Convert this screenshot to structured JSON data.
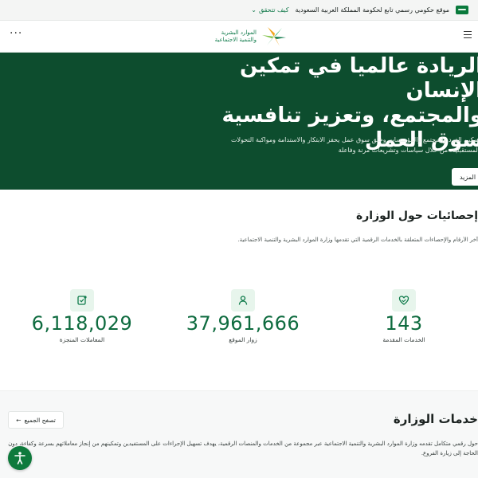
{
  "gov_bar": {
    "text": "موقع حكومي رسمي تابع لحكومة المملكة العربية السعودية",
    "verify_label": "كيف تتحقق"
  },
  "header": {
    "logo_line1": "الموارد البشرية",
    "logo_line2": "والتنمية الاجتماعية"
  },
  "hero": {
    "title_line1": "الريادة عالميا في تمكين الإنسان",
    "title_line2": "والمجتمع، وتعزيز تنافسية",
    "title_line3": "سوق العمل",
    "description_line1": "تمكين الفرد والمجتمع والمؤسسات وخلق سوق عمل يحفز الابتكار والاستدامة ومواكبة التحولات",
    "description_line2": "المستقبلية، من خلال سياسات وتشريعات مرنة وفاعلة",
    "more_label": "المزيد"
  },
  "stats": {
    "title": "إحصائيات حول الوزارة",
    "description": "آخر الأرقام والإحصاءات المتعلقة بالخدمات الرقمية التي تقدمها وزارة الموارد البشرية والتنمية الاجتماعية.",
    "items": [
      {
        "value": "143",
        "label": "الخدمات المقدمة",
        "icon": "heart-hand-icon"
      },
      {
        "value": "37,961,666",
        "label": "زوار الموقع",
        "icon": "user-icon"
      },
      {
        "value": "6,118,029",
        "label": "المعاملات المنجزة",
        "icon": "document-check-icon"
      }
    ]
  },
  "services": {
    "title": "خدمات الوزارة",
    "browse_label": "تصفح الجميع",
    "description_line1": "حول رقمي متكامل تقدمه وزارة الموارد البشرية والتنمية الاجتماعية عبر مجموعة من الخدمات والمنصات الرقمية، يهدف تسهيل الإجراءات على المستفيدين وتمكينهم من إنجاز معاملاتهم بسرعة وكفاءة، دون",
    "description_line2": "الحاجة إلى زيارة الفروع."
  },
  "colors": {
    "hero_bg": "#0d4d2e",
    "accent_green": "#0e6b3f",
    "icon_bg": "#e7f5ec",
    "a11y_button": "#0e7a3c"
  }
}
